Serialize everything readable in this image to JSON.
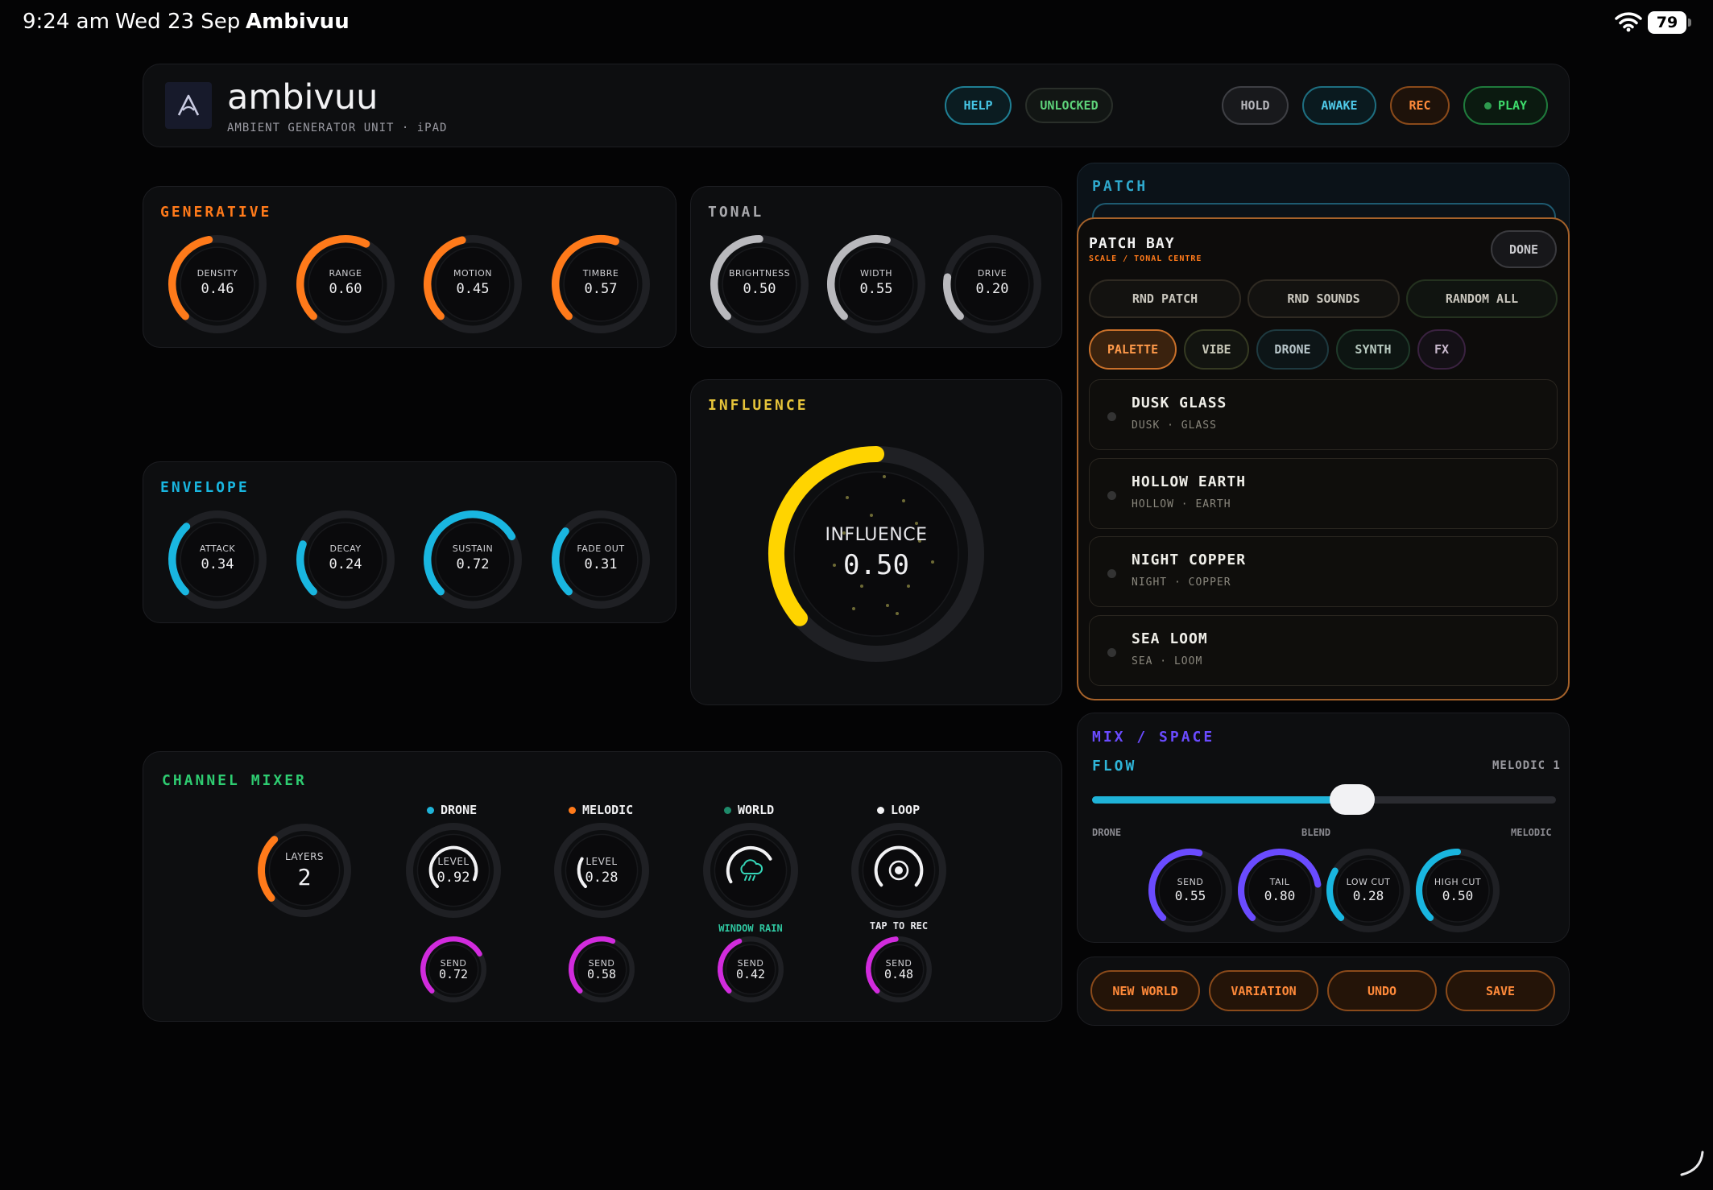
{
  "status": {
    "time": "9:24 am",
    "date": "Wed 23 Sep",
    "app": "Ambivuu",
    "battery": "79"
  },
  "header": {
    "name": "ambivuu",
    "subtitle": "AMBIENT GENERATOR UNIT · iPAD",
    "help": "HELP",
    "unlocked": "UNLOCKED",
    "hold": "HOLD",
    "awake": "AWAKE",
    "rec": "REC",
    "play": "PLAY"
  },
  "colors": {
    "orange": "#ff7a1a",
    "gray": "#b9b9bd",
    "cyan": "#19b6e0",
    "yellow": "#ffd400",
    "magenta": "#d12bdd",
    "purple": "#6a4bff",
    "green": "#2ecc71"
  },
  "generative": {
    "title": "GENERATIVE",
    "knobs": [
      {
        "label": "DENSITY",
        "value": "0.46",
        "level": 0.46
      },
      {
        "label": "RANGE",
        "value": "0.60",
        "level": 0.6
      },
      {
        "label": "MOTION",
        "value": "0.45",
        "level": 0.45
      },
      {
        "label": "TIMBRE",
        "value": "0.57",
        "level": 0.57
      }
    ]
  },
  "tonal": {
    "title": "TONAL",
    "knobs": [
      {
        "label": "BRIGHTNESS",
        "value": "0.50",
        "level": 0.5
      },
      {
        "label": "WIDTH",
        "value": "0.55",
        "level": 0.55
      },
      {
        "label": "DRIVE",
        "value": "0.20",
        "level": 0.2
      }
    ]
  },
  "envelope": {
    "title": "ENVELOPE",
    "knobs": [
      {
        "label": "ATTACK",
        "value": "0.34",
        "level": 0.34
      },
      {
        "label": "DECAY",
        "value": "0.24",
        "level": 0.24
      },
      {
        "label": "SUSTAIN",
        "value": "0.72",
        "level": 0.72
      },
      {
        "label": "FADE OUT",
        "value": "0.31",
        "level": 0.31
      }
    ]
  },
  "influence": {
    "title": "INFLUENCE",
    "label": "INFLUENCE",
    "value": "0.50",
    "level": 0.5
  },
  "patch": {
    "title": "PATCH"
  },
  "patchbay": {
    "title": "PATCH BAY",
    "subtitle": "SCALE / TONAL CENTRE",
    "done": "DONE",
    "rnd_patch": "RND PATCH",
    "rnd_sounds": "RND SOUNDS",
    "random_all": "RANDOM ALL",
    "tabs": [
      "PALETTE",
      "VIBE",
      "DRONE",
      "SYNTH",
      "FX"
    ],
    "items": [
      {
        "name": "DUSK GLASS",
        "sub": "DUSK · GLASS"
      },
      {
        "name": "HOLLOW EARTH",
        "sub": "HOLLOW · EARTH"
      },
      {
        "name": "NIGHT COPPER",
        "sub": "NIGHT · COPPER"
      },
      {
        "name": "SEA LOOM",
        "sub": "SEA · LOOM"
      }
    ]
  },
  "mix": {
    "title": "MIX / SPACE",
    "flow": "FLOW",
    "flow_value": "MELODIC 1",
    "flow_level": 0.56,
    "left": "DRONE",
    "center": "BLEND",
    "right": "MELODIC",
    "knobs": [
      {
        "label": "SEND",
        "value": "0.55",
        "level": 0.55
      },
      {
        "label": "TAIL",
        "value": "0.80",
        "level": 0.8
      },
      {
        "label": "LOW CUT",
        "value": "0.28",
        "level": 0.28
      },
      {
        "label": "HIGH CUT",
        "value": "0.50",
        "level": 0.5
      }
    ]
  },
  "actions": {
    "new_world": "NEW WORLD",
    "variation": "VARIATION",
    "undo": "UNDO",
    "save": "SAVE"
  },
  "mixer": {
    "title": "CHANNEL MIXER",
    "layers": {
      "label": "LAYERS",
      "value": "2"
    },
    "channels": [
      {
        "name": "DRONE",
        "label": "LEVEL",
        "value": "0.92",
        "level": 0.92,
        "send_label": "SEND",
        "send": "0.72",
        "send_level": 0.72
      },
      {
        "name": "MELODIC",
        "label": "LEVEL",
        "value": "0.28",
        "level": 0.28,
        "send_label": "SEND",
        "send": "0.58",
        "send_level": 0.58
      },
      {
        "name": "WORLD",
        "caption": "WINDOW RAIN",
        "send_label": "SEND",
        "send": "0.42",
        "send_level": 0.42
      },
      {
        "name": "LOOP",
        "caption": "TAP TO REC",
        "send_label": "SEND",
        "send": "0.48",
        "send_level": 0.48
      }
    ]
  }
}
